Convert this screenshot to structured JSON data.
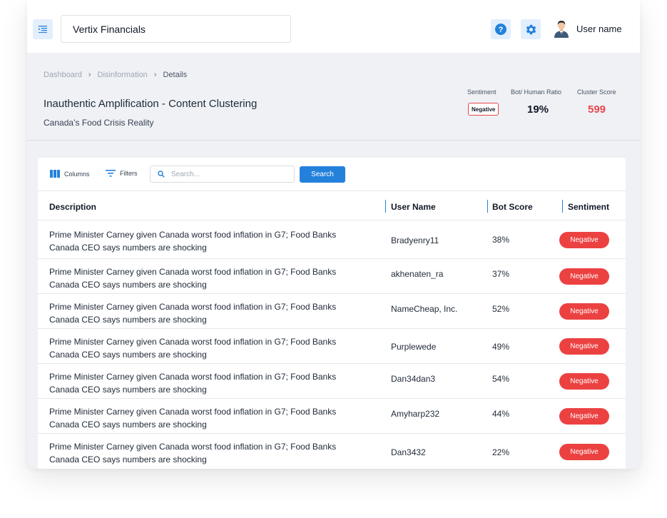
{
  "header": {
    "company_name": "Vertix Financials",
    "username": "User name"
  },
  "breadcrumb": [
    "Dashboard",
    "Disinformation",
    "Details"
  ],
  "page": {
    "title": "Inauthentic Amplification - Content Clustering",
    "subtitle": "Canada’s Food Crisis Reality"
  },
  "metrics": {
    "sentiment_label": "Sentiment",
    "sentiment_value": "Negative",
    "ratio_label": "Bot/ Human Ratio",
    "ratio_value": "19%",
    "score_label": "Cluster Score",
    "score_value": "599"
  },
  "toolbar": {
    "columns_label": "Columns",
    "filters_label": "Filters",
    "search_placeholder": "Search...",
    "search_button": "Search"
  },
  "table": {
    "headers": [
      "Description",
      "User Name",
      "Bot Score",
      "Sentiment"
    ],
    "rows": [
      {
        "line1": "Prime Minister Carney given Canada worst food inflation in G7; Food Banks",
        "line2": "Canada CEO says numbers are shocking",
        "user": "Bradyenry11",
        "bot": "38%",
        "sentiment": "Negative"
      },
      {
        "line1": "Prime Minister Carney given Canada worst food inflation in G7; Food Banks",
        "line2": "Canada CEO says numbers are shocking",
        "user": "akhenaten_ra",
        "bot": "37%",
        "sentiment": "Negative"
      },
      {
        "line1": "Prime Minister Carney given Canada worst food inflation in G7; Food Banks",
        "line2": "Canada CEO says numbers are shocking",
        "user": "NameCheap, Inc.",
        "bot": "52%",
        "sentiment": "Negative"
      },
      {
        "line1": "Prime Minister Carney given Canada worst food inflation in G7; Food Banks",
        "line2": "Canada CEO says numbers are shocking",
        "user": "Purplewede",
        "bot": "49%",
        "sentiment": "Negative"
      },
      {
        "line1": "Prime Minister Carney given Canada worst food inflation in G7; Food Banks",
        "line2": "Canada CEO says numbers are shocking",
        "user": "Dan34dan3",
        "bot": "54%",
        "sentiment": "Negative"
      },
      {
        "line1": "Prime Minister Carney given Canada worst food inflation in G7; Food Banks",
        "line2": "Canada CEO says numbers are shocking",
        "user": "Amyharp232",
        "bot": "44%",
        "sentiment": "Negative"
      },
      {
        "line1": "Prime Minister Carney given Canada worst food inflation in G7; Food Banks",
        "line2": "Canada CEO says numbers are shocking",
        "user": "Dan3432",
        "bot": "22%",
        "sentiment": "Negative"
      }
    ]
  },
  "icons": {
    "menu": "menu-collapse-icon",
    "help": "help-icon",
    "settings": "gear-icon",
    "avatar": "user-avatar-icon",
    "columns": "columns-icon",
    "filters": "filter-icon",
    "search": "search-icon",
    "breadcrumb_separator": "chevron-right-icon"
  },
  "colors": {
    "accent": "#2481db",
    "negative": "#ec4141",
    "score": "#e5484d",
    "page_bg": "#eff1f5"
  }
}
